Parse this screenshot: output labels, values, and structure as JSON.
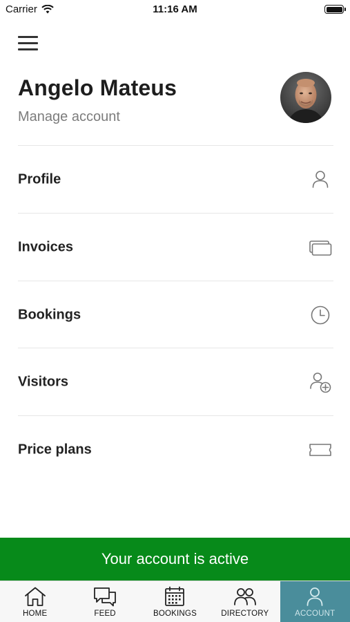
{
  "status_bar": {
    "carrier": "Carrier",
    "time": "11:16 AM"
  },
  "header": {
    "name": "Angelo Mateus",
    "manage_account": "Manage account"
  },
  "menu": [
    {
      "label": "Profile",
      "icon": "user-icon"
    },
    {
      "label": "Invoices",
      "icon": "cards-icon"
    },
    {
      "label": "Bookings",
      "icon": "clock-icon"
    },
    {
      "label": "Visitors",
      "icon": "add-user-icon"
    },
    {
      "label": "Price plans",
      "icon": "ticket-icon"
    }
  ],
  "banner": {
    "text": "Your account is active",
    "color": "#078a1a"
  },
  "tabs": [
    {
      "label": "HOME",
      "icon": "home-icon",
      "active": false
    },
    {
      "label": "FEED",
      "icon": "chat-icon",
      "active": false
    },
    {
      "label": "BOOKINGS",
      "icon": "calendar-icon",
      "active": false
    },
    {
      "label": "DIRECTORY",
      "icon": "people-icon",
      "active": false
    },
    {
      "label": "ACCOUNT",
      "icon": "user-icon",
      "active": true
    }
  ],
  "colors": {
    "active_tab": "#4a8d9b",
    "icon_gray": "#777777"
  }
}
